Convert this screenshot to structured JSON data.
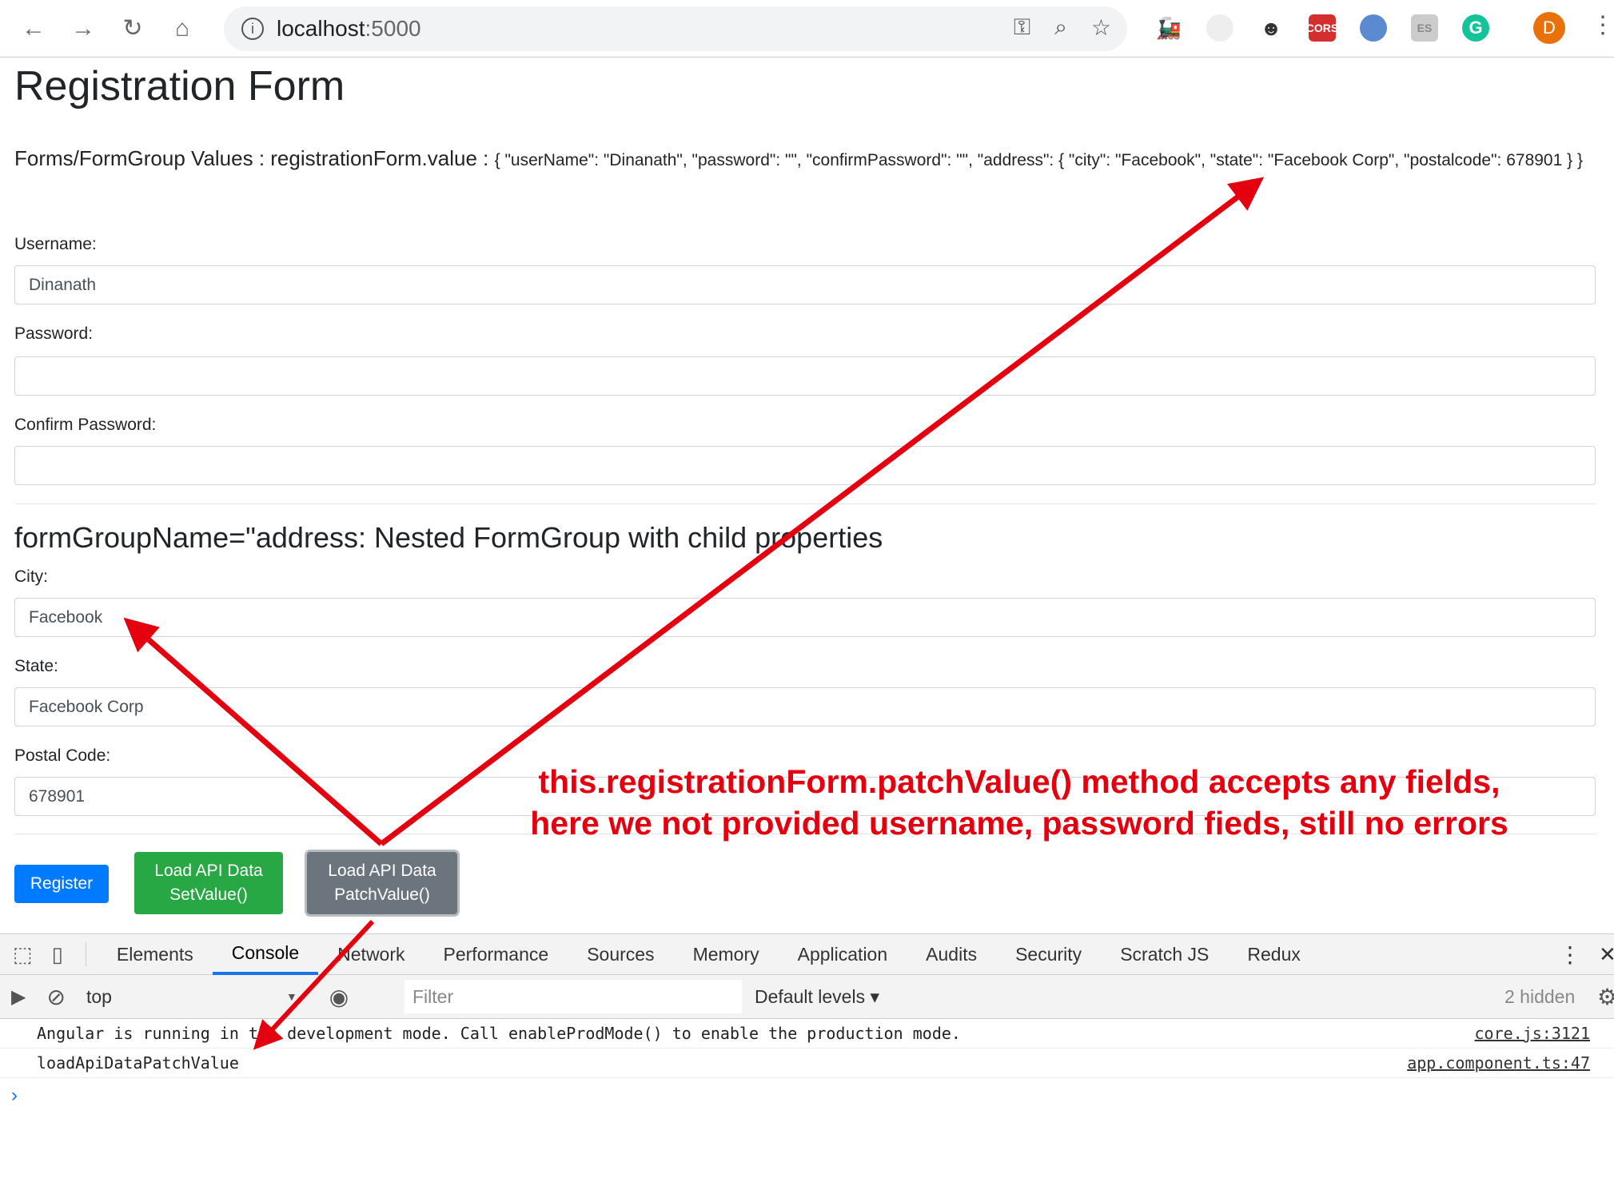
{
  "browser": {
    "url_host": "localhost",
    "url_port": ":5000",
    "avatar_letter": "D",
    "extensions": [
      "ext-train-icon",
      "ext-circle-icon",
      "ext-spy-icon",
      "cors-icon",
      "ext-drop-icon",
      "es-icon",
      "grammarly-icon"
    ],
    "cors_label": "CORS",
    "es_label": "ES",
    "grammarly_label": "G"
  },
  "page": {
    "title": "Registration Form",
    "values_label": "Forms/FormGroup Values : registrationForm.value :",
    "values_json": "{ \"userName\": \"Dinanath\", \"password\": \"\", \"confirmPassword\": \"\", \"address\": { \"city\": \"Facebook\", \"state\": \"Facebook Corp\", \"postalcode\": 678901 } }",
    "fields": [
      {
        "label": "Username:",
        "value": "Dinanath"
      },
      {
        "label": "Password:",
        "value": ""
      },
      {
        "label": "Confirm Password:",
        "value": ""
      }
    ],
    "address_heading": "formGroupName=\"address: Nested FormGroup with child properties",
    "address_fields": [
      {
        "label": "City:",
        "value": "Facebook"
      },
      {
        "label": "State:",
        "value": "Facebook Corp"
      },
      {
        "label": "Postal Code:",
        "value": "678901"
      }
    ],
    "buttons": {
      "register": "Register",
      "setvalue_line1": "Load API Data",
      "setvalue_line2": "SetValue()",
      "patch_line1": "Load API Data",
      "patch_line2": "PatchValue()"
    },
    "colors": {
      "primary": "#007bff",
      "success": "#28a745",
      "secondary": "#6c757d",
      "annotation": "#e4000f"
    }
  },
  "annotation": {
    "line1": "this.registrationForm.patchValue() method accepts any fields,",
    "line2": "here we not provided username, password fieds, still no errors"
  },
  "devtools": {
    "tabs": [
      "Elements",
      "Console",
      "Network",
      "Performance",
      "Sources",
      "Memory",
      "Application",
      "Audits",
      "Security",
      "Scratch JS",
      "Redux"
    ],
    "active_tab": "Console",
    "context": "top",
    "filter_placeholder": "Filter",
    "levels": "Default levels ▾",
    "hidden": "2 hidden",
    "logs": [
      {
        "message": "Angular is running in the development mode. Call enableProdMode() to enable the production mode.",
        "source": "core.js:3121"
      },
      {
        "message": "loadApiDataPatchValue",
        "source": "app.component.ts:47"
      }
    ]
  }
}
